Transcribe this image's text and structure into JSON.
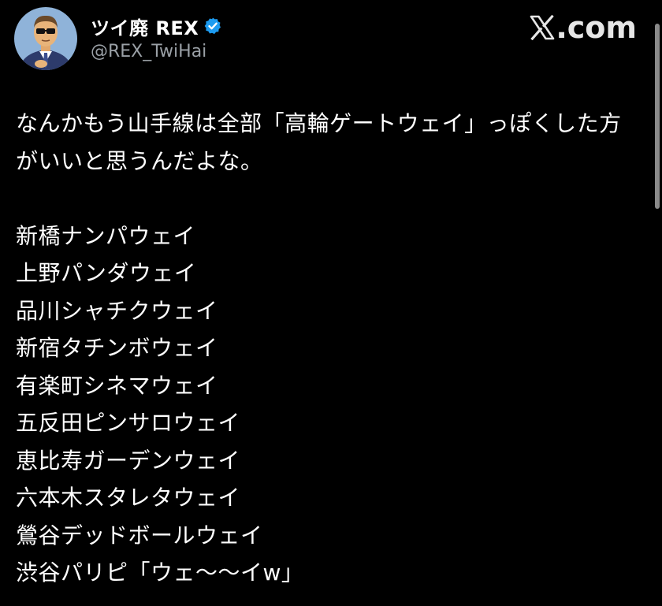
{
  "author": {
    "display_name": "ツイ廃 REX",
    "handle": "@REX_TwiHai",
    "verified_icon": "verified-badge-icon",
    "verified_color": "#1d9bf0"
  },
  "brand": {
    "text": ".com",
    "logo_icon": "x-logo-icon"
  },
  "tweet": {
    "line1": "なんかもう山手線は全部「高輪ゲートウェイ」っぽくした方",
    "line2": "がいいと思うんだよな。",
    "stations": [
      "新橋ナンパウェイ",
      "上野パンダウェイ",
      "品川シャチクウェイ",
      "新宿タチンボウェイ",
      "有楽町シネマウェイ",
      "五反田ピンサロウェイ",
      "恵比寿ガーデンウェイ",
      "六本木スタレタウェイ",
      "鶯谷デッドボールウェイ",
      "渋谷パリピ「ウェ〜〜イw」"
    ]
  },
  "colors": {
    "background": "#000000",
    "text": "#ffffff",
    "handle": "#9aa0a6"
  }
}
